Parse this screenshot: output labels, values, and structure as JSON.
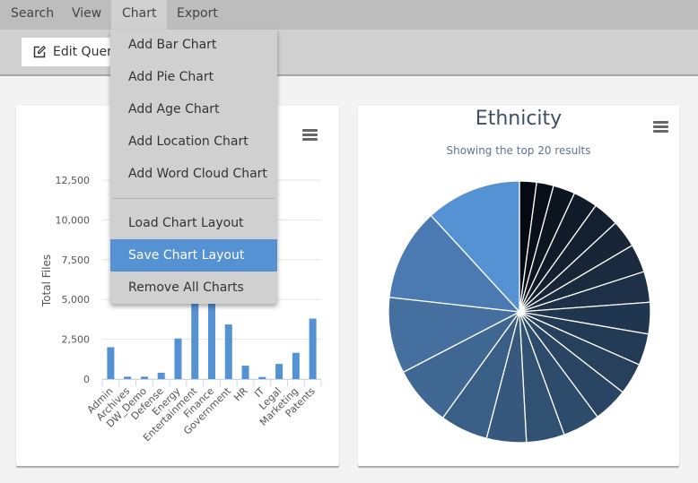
{
  "menubar": {
    "items": [
      {
        "label": "Search"
      },
      {
        "label": "View"
      },
      {
        "label": "Chart",
        "active": true
      },
      {
        "label": "Export"
      }
    ]
  },
  "toolbar": {
    "edit_query_label": "Edit Query",
    "edit_icon": "edit-icon"
  },
  "chart_menu": {
    "items": [
      {
        "label": "Add Bar Chart"
      },
      {
        "label": "Add Pie Chart"
      },
      {
        "label": "Add Age Chart"
      },
      {
        "label": "Add Location Chart"
      },
      {
        "label": "Add Word Cloud Chart"
      },
      {
        "label": "Load Chart Layout"
      },
      {
        "label": "Save Chart Layout",
        "highlighted": true
      },
      {
        "label": "Remove All Charts"
      }
    ],
    "highlight_color": "#5592d4"
  },
  "chart_data": [
    {
      "type": "bar",
      "title": "",
      "xlabel": "",
      "ylabel": "Total Files",
      "ylim": [
        0,
        12500
      ],
      "yticks": [
        "0",
        "2,500",
        "5,000",
        "7,500",
        "10,000",
        "12,500"
      ],
      "ytick_values": [
        0,
        2500,
        5000,
        7500,
        10000,
        12500
      ],
      "grid": true,
      "bar_color": "#5592d4",
      "categories": [
        "Admin",
        "Archives",
        "DW_Demo",
        "Defense",
        "Energy",
        "Entertainment",
        "Finance",
        "Government",
        "HR",
        "IT",
        "Legal",
        "Marketing",
        "Patents"
      ],
      "values": [
        2000,
        150,
        150,
        400,
        2550,
        6000,
        6000,
        3430,
        840,
        130,
        950,
        1650,
        3800
      ]
    },
    {
      "type": "pie",
      "title": "Ethnicity",
      "subtitle": "Showing the top 20 results",
      "legend": "none",
      "values_percent": [
        2.1,
        2.1,
        2.7,
        3.0,
        3.2,
        3.4,
        3.5,
        3.8,
        3.9,
        3.9,
        3.9,
        4.3,
        4.6,
        4.7,
        4.9,
        5.9,
        7.4,
        9.4,
        11.4,
        11.8
      ],
      "colors": [
        "#040a12",
        "#080f18",
        "#0c1520",
        "#101b29",
        "#141f2f",
        "#172537",
        "#1a2a3f",
        "#1d3047",
        "#20354e",
        "#233a55",
        "#27405c",
        "#2a4563",
        "#2d4b6b",
        "#315173",
        "#36587c",
        "#3a5f87",
        "#3f6792",
        "#446f9f",
        "#4a7ab1",
        "#5592d4"
      ]
    }
  ]
}
